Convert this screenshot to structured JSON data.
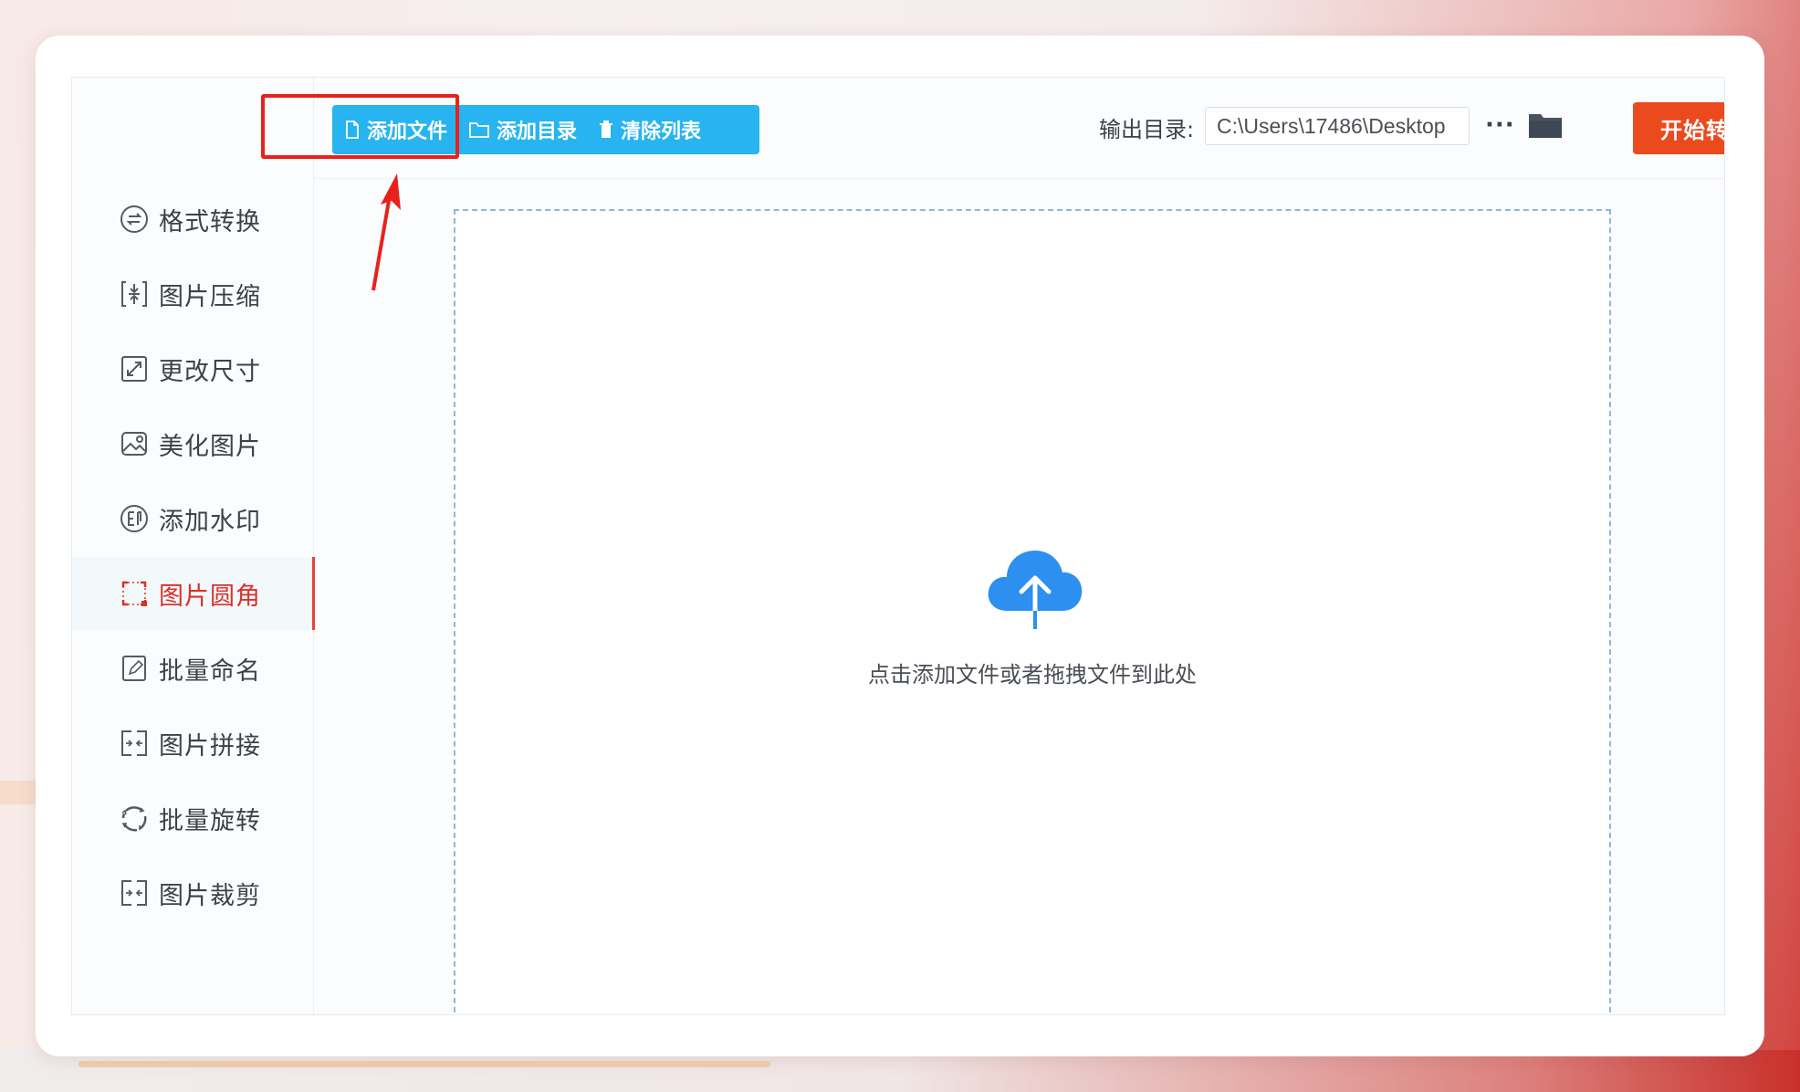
{
  "sidebar": {
    "items": [
      {
        "label": "格式转换",
        "icon": "format-convert-icon"
      },
      {
        "label": "图片压缩",
        "icon": "compress-icon"
      },
      {
        "label": "更改尺寸",
        "icon": "resize-icon"
      },
      {
        "label": "美化图片",
        "icon": "beautify-icon"
      },
      {
        "label": "添加水印",
        "icon": "watermark-icon"
      },
      {
        "label": "图片圆角",
        "icon": "rounded-corner-icon",
        "active": true
      },
      {
        "label": "批量命名",
        "icon": "rename-icon"
      },
      {
        "label": "图片拼接",
        "icon": "stitch-icon"
      },
      {
        "label": "批量旋转",
        "icon": "rotate-icon"
      },
      {
        "label": "图片裁剪",
        "icon": "crop-icon"
      }
    ]
  },
  "toolbar": {
    "add_file_label": "添加文件",
    "add_folder_label": "添加目录",
    "clear_list_label": "清除列表",
    "output_label": "输出目录:",
    "output_path": "C:\\Users\\17486\\Desktop",
    "more_label": "···",
    "start_label": "开始转换"
  },
  "dropzone": {
    "hint": "点击添加文件或者拖拽文件到此处"
  },
  "colors": {
    "accent_blue": "#27b4f0",
    "start_red": "#eb4a1f",
    "active_red": "#d9322a",
    "annotation_red": "#e8211b"
  }
}
